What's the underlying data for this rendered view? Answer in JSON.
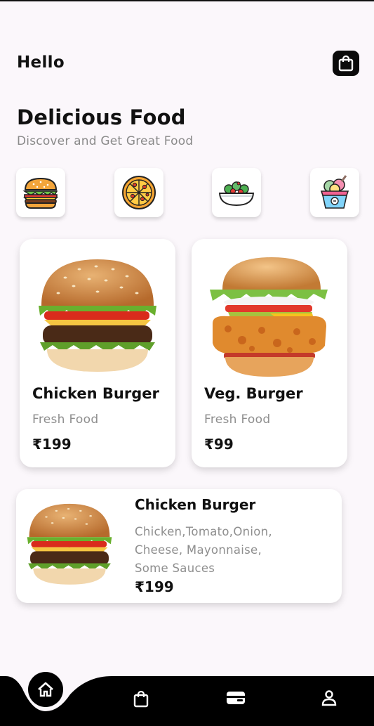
{
  "header": {
    "greeting": "Hello",
    "bag_icon": "shopping-bag-icon"
  },
  "hero": {
    "title": "Delicious Food",
    "subtitle": "Discover and Get Great Food"
  },
  "categories": [
    {
      "icon": "burger-icon"
    },
    {
      "icon": "pizza-icon"
    },
    {
      "icon": "salad-bowl-icon"
    },
    {
      "icon": "ice-cream-icon"
    }
  ],
  "featured": [
    {
      "name": "Chicken Burger",
      "tag": "Fresh Food",
      "price": "₹199"
    },
    {
      "name": "Veg. Burger",
      "tag": "Fresh Food",
      "price": "₹99"
    }
  ],
  "detail": {
    "name": "Chicken Burger",
    "description_lines": [
      "Chicken,Tomato,Onion,",
      "Cheese, Mayonnaise,",
      "Some Sauces"
    ],
    "price": "₹199"
  },
  "bottom_nav": [
    {
      "icon": "home-icon"
    },
    {
      "icon": "shopping-bag-icon"
    },
    {
      "icon": "wallet-icon"
    },
    {
      "icon": "profile-icon"
    }
  ],
  "colors": {
    "background": "#fbf7fb",
    "nav_bar": "#000000",
    "muted_text": "#8e8e8e"
  }
}
